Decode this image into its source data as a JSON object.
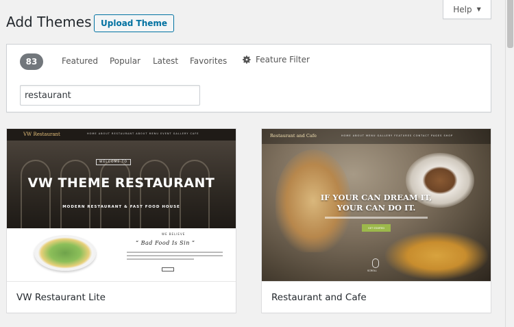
{
  "header": {
    "title": "Add Themes",
    "upload_label": "Upload Theme",
    "help_label": "Help"
  },
  "filter": {
    "count": "83",
    "links": [
      "Featured",
      "Popular",
      "Latest",
      "Favorites"
    ],
    "feature_filter_label": "Feature Filter",
    "search_value": "restaurant"
  },
  "themes": [
    {
      "name": "VW Restaurant Lite",
      "preview": {
        "logo": "VW Restaurant",
        "nav": "HOME   ABOUT   RESTAURANT   ABOUT   MENU   EVENT   GALLERY   CAFE",
        "welcome": "WELCOME TO",
        "hero_title": "VW THEME RESTAURANT",
        "hero_subtitle": "MODERN RESTAURANT & FAST FOOD HOUSE",
        "believe": "WE BELIEVE",
        "quote": "“ Bad Food Is Sin ”"
      }
    },
    {
      "name": "Restaurant and Cafe",
      "preview": {
        "logo": "Restaurant and Cafe",
        "nav": "HOME   ABOUT   MENU   GALLERY   FEATURES   CONTACT   PAGES   SHOP",
        "headline_1": "IF YOUR CAN DREAM IT,",
        "headline_2": "YOUR CAN DO IT.",
        "button": "GET STARTED",
        "scroll": "SCROLL"
      }
    }
  ]
}
